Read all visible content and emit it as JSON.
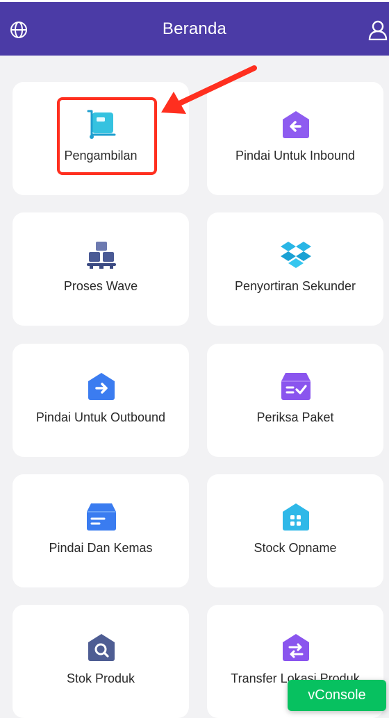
{
  "header": {
    "title": "Beranda",
    "left_icon": "globe-icon",
    "right_icon": "user-icon",
    "bg_color": "#4b3ba6"
  },
  "menu": [
    {
      "label": "Pengambilan",
      "icon": "cart-icon"
    },
    {
      "label": "Pindai Untuk Inbound",
      "icon": "inbound-icon"
    },
    {
      "label": "Proses Wave",
      "icon": "pallet-icon"
    },
    {
      "label": "Penyortiran Sekunder",
      "icon": "dropbox-icon"
    },
    {
      "label": "Pindai Untuk Outbound",
      "icon": "outbound-icon"
    },
    {
      "label": "Periksa Paket",
      "icon": "check-package-icon"
    },
    {
      "label": "Pindai Dan Kemas",
      "icon": "scan-pack-icon"
    },
    {
      "label": "Stock Opname",
      "icon": "stock-opname-icon"
    },
    {
      "label": "Stok Produk",
      "icon": "search-product-icon"
    },
    {
      "label": "Transfer Lokasi Produk",
      "icon": "transfer-icon"
    }
  ],
  "vconsole": {
    "label": "vConsole",
    "color": "#07c160"
  },
  "annotation": {
    "color": "#ff2f1f"
  }
}
